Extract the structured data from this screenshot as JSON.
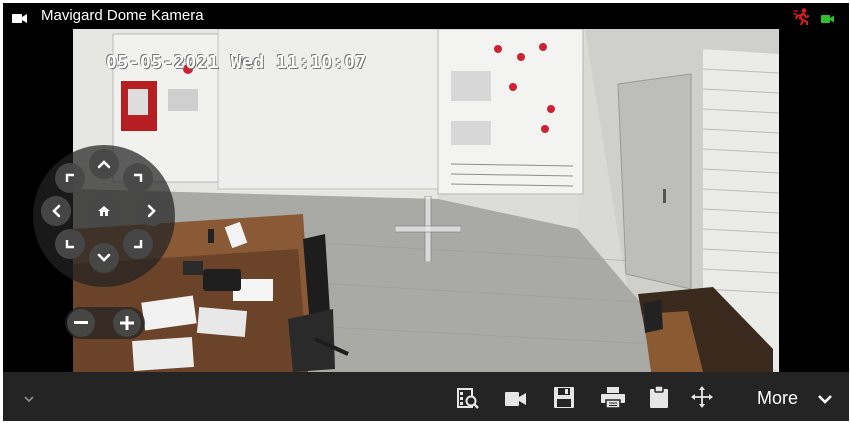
{
  "window": {
    "title": "Mavigard Dome Kamera",
    "status_icons": [
      "camera-icon",
      "motion-detected-icon",
      "recording-camera-icon"
    ]
  },
  "video": {
    "timestamp": "05-05-2021 Wed 11:10:07"
  },
  "ptz": {
    "buttons": [
      "pan-up",
      "pan-down",
      "pan-left",
      "pan-right",
      "pan-up-left",
      "pan-up-right",
      "pan-down-left",
      "pan-down-right",
      "home"
    ],
    "zoom": [
      "zoom-out",
      "zoom-in"
    ]
  },
  "toolbar": {
    "icons": [
      "playback-search-icon",
      "camera-icon",
      "save-icon",
      "print-icon",
      "clipboard-icon",
      "move-icon"
    ],
    "more_label": "More"
  },
  "colors": {
    "background": "#000000",
    "toolbar": "#242424",
    "text": "#ffffff",
    "motion_alert": "#e21b1b",
    "recording": "#2fbf2f"
  }
}
